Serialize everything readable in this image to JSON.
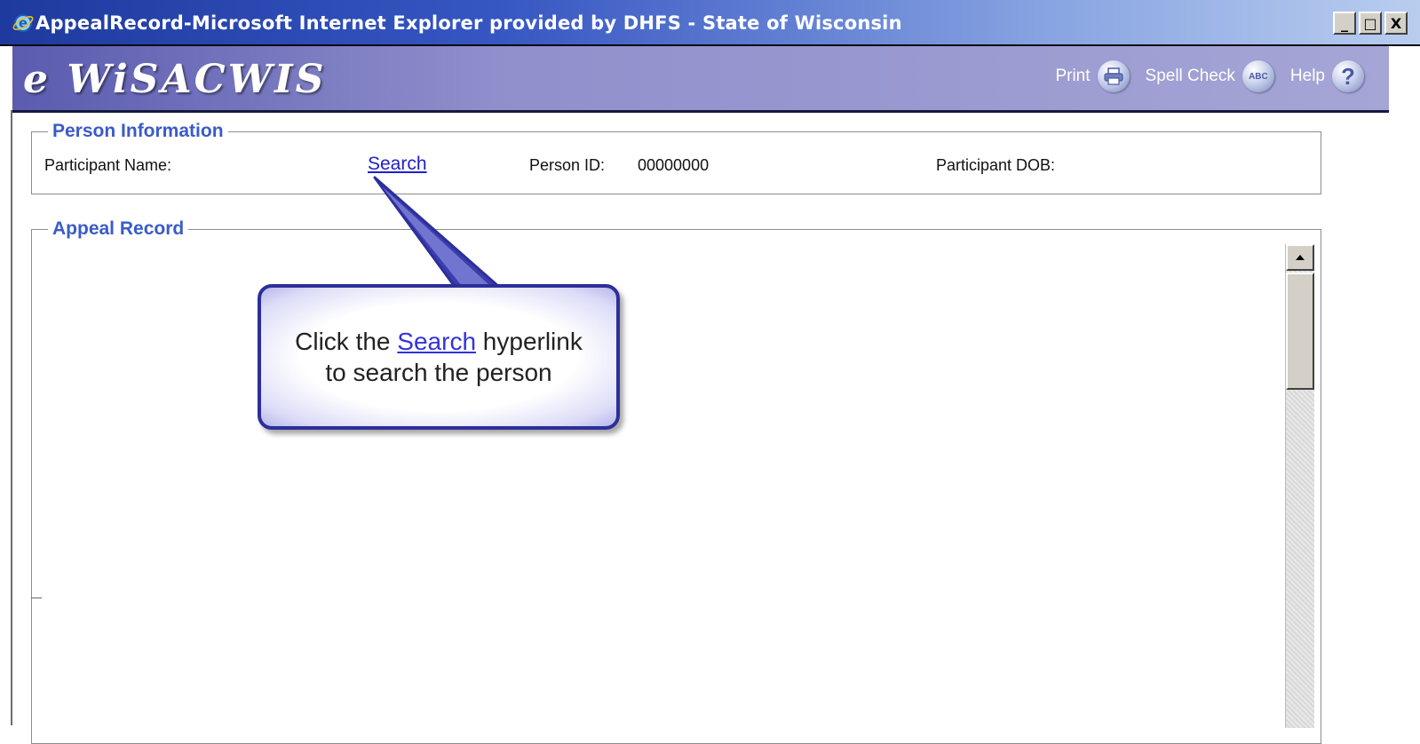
{
  "window": {
    "title": "AppealRecord-Microsoft Internet Explorer provided by DHFS - State of Wisconsin",
    "minimize": "_",
    "maximize": "□",
    "close": "X"
  },
  "header": {
    "brand": "e WiSACWIS",
    "print_label": "Print",
    "spellcheck_label": "Spell Check",
    "spellcheck_icon_text": "ABC",
    "help_label": "Help",
    "help_icon_text": "?"
  },
  "person_info": {
    "legend": "Person Information",
    "participant_name_label": "Participant Name:",
    "search_link": "Search",
    "person_id_label": "Person ID:",
    "person_id_value": "00000000",
    "dob_label": "Participant DOB:"
  },
  "appeal_record": {
    "legend": "Appeal Record"
  },
  "callout": {
    "line1_before": "Click the",
    "line1_link": "Search",
    "line1_after": "hyperlink",
    "line2": "to search the person"
  },
  "colors": {
    "legend": "#3a5bc8",
    "link": "#2020c8",
    "callout_border": "#2c2f9a"
  }
}
